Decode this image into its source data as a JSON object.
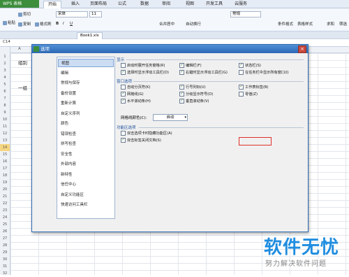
{
  "app": {
    "logo_text": "WPS 表格"
  },
  "tabs": [
    "开始",
    "插入",
    "页面布局",
    "公式",
    "数据",
    "审阅",
    "视图",
    "开发工具",
    "云服务"
  ],
  "ribbon": {
    "cut": "剪切",
    "paste": "粘贴",
    "copy": "复制",
    "format_painter": "格式刷",
    "font": "宋体",
    "font_size": "11",
    "merge_center": "合并居中",
    "wrap": "自动换行",
    "number_format": "常规",
    "cond_format": "条件格式",
    "table_style": "表格样式",
    "sum": "求和",
    "filter": "筛选"
  },
  "doc_tab": "Book1.xls",
  "name_box": "C14",
  "sheet": {
    "rows": [
      "1",
      "2",
      "3",
      "4",
      "5",
      "6",
      "7",
      "8",
      "9",
      "10",
      "11",
      "12",
      "13",
      "14",
      "15",
      "16",
      "17",
      "18",
      "19",
      "20",
      "21",
      "22",
      "23",
      "24",
      "25",
      "26",
      "27",
      "28",
      "29",
      "30",
      "31",
      "32"
    ],
    "selected_row": "14",
    "cells": {
      "col_a_header": "A",
      "b_label": "组别",
      "b_value": "一组"
    }
  },
  "dialog": {
    "title": "选项",
    "nav": [
      "视图",
      "编辑",
      "常规与保存",
      "备份设置",
      "重新计算",
      "自定义序列",
      "颜色",
      "错误检查",
      "拼写检查",
      "安全性",
      "外部内容",
      "新特性",
      "信任中心",
      "自定义功能区",
      "快速访问工具栏"
    ],
    "nav_selected": 0,
    "section_display": "显示",
    "display_options": [
      {
        "label": "启动时展开任务窗格(R)",
        "checked": false
      },
      {
        "label": "编辑栏(F)",
        "checked": true
      },
      {
        "label": "状态栏(S)",
        "checked": true
      },
      {
        "label": "选择时显示浮动工具栏(D)",
        "checked": true
      },
      {
        "label": "右键时显示浮动工具栏(G)",
        "checked": true
      },
      {
        "label": "在任务栏中显示所有窗口(I)",
        "checked": false
      }
    ],
    "section_window": "窗口选项",
    "window_options": [
      {
        "label": "自动分页符(K)",
        "checked": false
      },
      {
        "label": "行号列标(U)",
        "checked": true
      },
      {
        "label": "工作表标签(B)",
        "checked": true
      },
      {
        "label": "网格线(G)",
        "checked": true
      },
      {
        "label": "分级显示符号(O)",
        "checked": true
      },
      {
        "label": "零值(Z)",
        "checked": false
      },
      {
        "label": "水平滚动条(H)",
        "checked": true
      },
      {
        "label": "垂直滚动条(V)",
        "checked": true
      }
    ],
    "grid_color_label": "网格线颜色(C):",
    "grid_color_value": "自动",
    "section_ribbon": "功能区选项",
    "ribbon_options": [
      {
        "label": "双击选项卡时隐藏功能区(A)",
        "checked": false
      },
      {
        "label": "双击标签关闭文档(S)",
        "checked": true
      }
    ]
  },
  "watermark": {
    "line1": "软件无忧",
    "line2": "努力解决软件问题"
  },
  "colors": {
    "accent": "#2c67b4",
    "highlight": "#e0302a",
    "watermark": "#1f8de0"
  }
}
